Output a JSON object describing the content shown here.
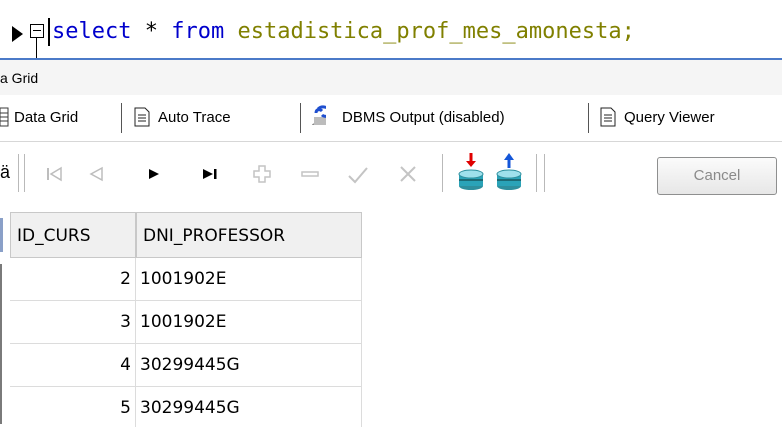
{
  "editor": {
    "keyword_select": "select",
    "operator_star": "*",
    "keyword_from": "from",
    "table_name": "estadistica_prof_mes_amonesta",
    "terminator": ";"
  },
  "caption": "a Grid",
  "tabs": [
    {
      "label": "Data Grid",
      "icon": "grid-icon",
      "active": true
    },
    {
      "label": "Auto Trace",
      "icon": "document-icon"
    },
    {
      "label": "DBMS Output (disabled)",
      "icon": "dbms-icon"
    },
    {
      "label": "Query Viewer",
      "icon": "document-icon"
    }
  ],
  "toolbar": {
    "first_glyph": "ä",
    "buttons": [
      "first-record-icon",
      "prior-record-icon",
      "next-record-icon",
      "last-record-icon",
      "insert-record-icon",
      "delete-record-icon",
      "post-edit-icon",
      "cancel-edit-icon",
      "import-icon",
      "export-icon"
    ],
    "cancel_label": "Cancel"
  },
  "grid": {
    "columns": [
      "ID_CURS",
      "DNI_PROFESSOR"
    ],
    "rows": [
      [
        "2",
        "1001902E"
      ],
      [
        "3",
        "1001902E"
      ],
      [
        "4",
        "30299445G"
      ],
      [
        "5",
        "30299445G"
      ]
    ]
  },
  "colors": {
    "keyword": "#0000cc",
    "identifier": "#808000",
    "header_bg": "#f0f0f0",
    "caption_border": "#4b7ac8"
  }
}
